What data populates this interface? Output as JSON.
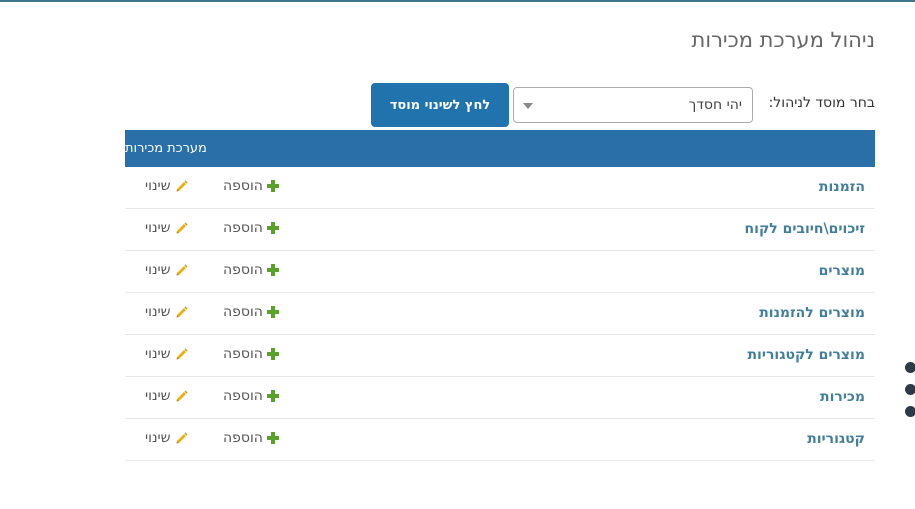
{
  "page_title": "ניהול מערכת מכירות",
  "org_selector": {
    "label": "בחר מוסד לניהול:",
    "selected": "יהי חסדך"
  },
  "change_org_button": "לחץ לשינוי מוסד",
  "module": {
    "header": "מערכת מכירות",
    "add_label": "הוספה",
    "change_label": "שינוי",
    "rows": [
      {
        "name": "הזמנות"
      },
      {
        "name": "זיכוים\\חיובים לקוח"
      },
      {
        "name": "מוצרים"
      },
      {
        "name": "מוצרים להזמנות"
      },
      {
        "name": "מוצרים לקטגוריות"
      },
      {
        "name": "מכירות"
      },
      {
        "name": "קטגוריות"
      }
    ]
  },
  "colors": {
    "header_bg": "#2a6fa7",
    "button_bg": "#2073ac",
    "link": "#447e9b",
    "add_icon": "#5aa02c",
    "change_icon": "#e8b10d"
  }
}
